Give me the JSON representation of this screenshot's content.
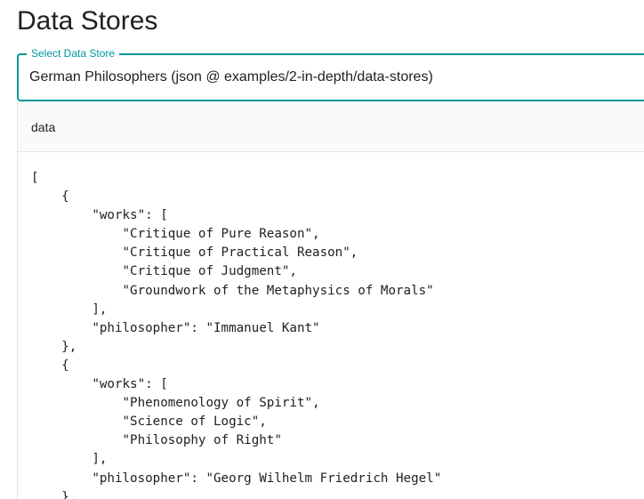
{
  "page": {
    "title": "Data Stores"
  },
  "select": {
    "label": "Select Data Store",
    "value": "German Philosophers (json @ examples/2-in-depth/data-stores)"
  },
  "panel": {
    "header": "data",
    "content": "[\n    {\n        \"works\": [\n            \"Critique of Pure Reason\",\n            \"Critique of Practical Reason\",\n            \"Critique of Judgment\",\n            \"Groundwork of the Metaphysics of Morals\"\n        ],\n        \"philosopher\": \"Immanuel Kant\"\n    },\n    {\n        \"works\": [\n            \"Phenomenology of Spirit\",\n            \"Science of Logic\",\n            \"Philosophy of Right\"\n        ],\n        \"philosopher\": \"Georg Wilhelm Friedrich Hegel\"\n    },"
  },
  "colors": {
    "accent": "#00979d",
    "text": "#212121",
    "header_bg": "#fafafa",
    "border": "#e3e3e3"
  }
}
